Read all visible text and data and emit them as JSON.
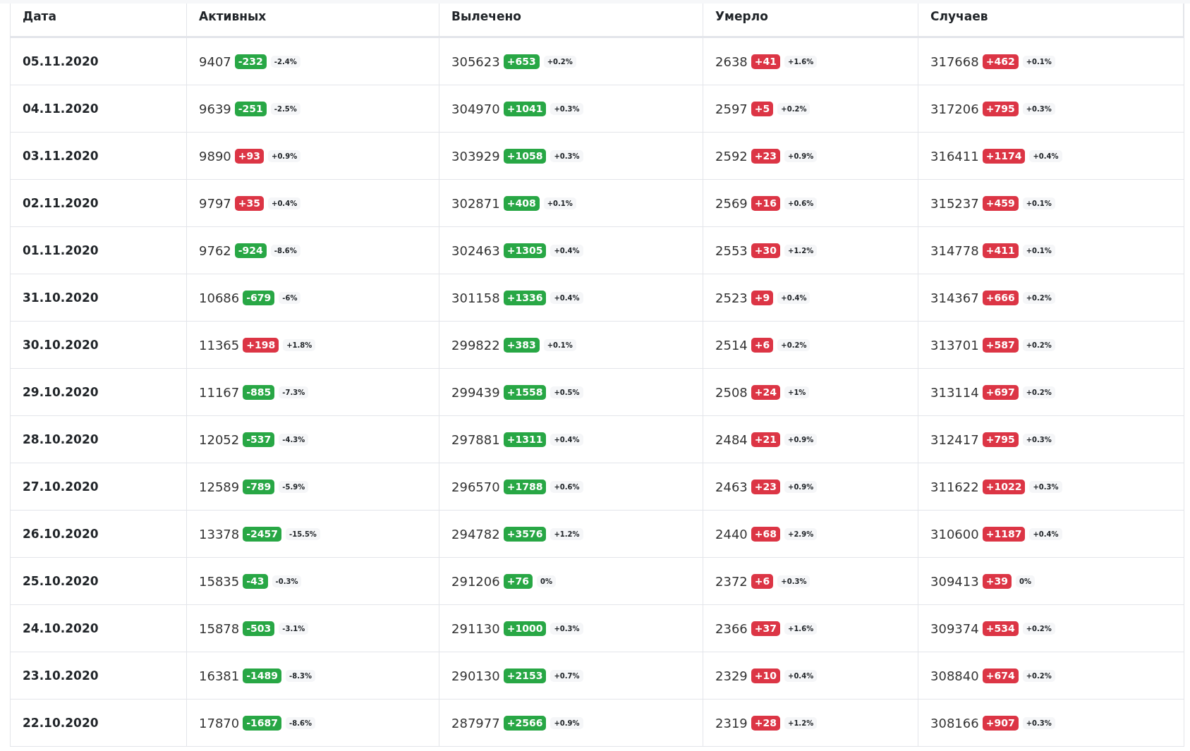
{
  "table": {
    "columns": [
      "Дата",
      "Активных",
      "Вылечено",
      "Умерло",
      "Случаев"
    ],
    "rows": [
      {
        "cells": [
          {
            "kind": "date",
            "text": "05.11.2020"
          },
          {
            "kind": "count",
            "value": "9407",
            "change": "-232",
            "color": "#28a745",
            "percent": "-2.4%"
          },
          {
            "kind": "count",
            "value": "305623",
            "change": "+653",
            "color": "#28a745",
            "percent": "+0.2%"
          },
          {
            "kind": "count",
            "value": "2638",
            "change": "+41",
            "color": "#dc3545",
            "percent": "+1.6%"
          },
          {
            "kind": "count",
            "value": "317668",
            "change": "+462",
            "color": "#dc3545",
            "percent": "+0.1%"
          }
        ]
      },
      {
        "cells": [
          {
            "kind": "date",
            "text": "04.11.2020"
          },
          {
            "kind": "count",
            "value": "9639",
            "change": "-251",
            "color": "#28a745",
            "percent": "-2.5%"
          },
          {
            "kind": "count",
            "value": "304970",
            "change": "+1041",
            "color": "#28a745",
            "percent": "+0.3%"
          },
          {
            "kind": "count",
            "value": "2597",
            "change": "+5",
            "color": "#dc3545",
            "percent": "+0.2%"
          },
          {
            "kind": "count",
            "value": "317206",
            "change": "+795",
            "color": "#dc3545",
            "percent": "+0.3%"
          }
        ]
      },
      {
        "cells": [
          {
            "kind": "date",
            "text": "03.11.2020"
          },
          {
            "kind": "count",
            "value": "9890",
            "change": "+93",
            "color": "#dc3545",
            "percent": "+0.9%"
          },
          {
            "kind": "count",
            "value": "303929",
            "change": "+1058",
            "color": "#28a745",
            "percent": "+0.3%"
          },
          {
            "kind": "count",
            "value": "2592",
            "change": "+23",
            "color": "#dc3545",
            "percent": "+0.9%"
          },
          {
            "kind": "count",
            "value": "316411",
            "change": "+1174",
            "color": "#dc3545",
            "percent": "+0.4%"
          }
        ]
      },
      {
        "cells": [
          {
            "kind": "date",
            "text": "02.11.2020"
          },
          {
            "kind": "count",
            "value": "9797",
            "change": "+35",
            "color": "#dc3545",
            "percent": "+0.4%"
          },
          {
            "kind": "count",
            "value": "302871",
            "change": "+408",
            "color": "#28a745",
            "percent": "+0.1%"
          },
          {
            "kind": "count",
            "value": "2569",
            "change": "+16",
            "color": "#dc3545",
            "percent": "+0.6%"
          },
          {
            "kind": "count",
            "value": "315237",
            "change": "+459",
            "color": "#dc3545",
            "percent": "+0.1%"
          }
        ]
      },
      {
        "cells": [
          {
            "kind": "date",
            "text": "01.11.2020"
          },
          {
            "kind": "count",
            "value": "9762",
            "change": "-924",
            "color": "#28a745",
            "percent": "-8.6%"
          },
          {
            "kind": "count",
            "value": "302463",
            "change": "+1305",
            "color": "#28a745",
            "percent": "+0.4%"
          },
          {
            "kind": "count",
            "value": "2553",
            "change": "+30",
            "color": "#dc3545",
            "percent": "+1.2%"
          },
          {
            "kind": "count",
            "value": "314778",
            "change": "+411",
            "color": "#dc3545",
            "percent": "+0.1%"
          }
        ]
      },
      {
        "cells": [
          {
            "kind": "date",
            "text": "31.10.2020"
          },
          {
            "kind": "count",
            "value": "10686",
            "change": "-679",
            "color": "#28a745",
            "percent": "-6%"
          },
          {
            "kind": "count",
            "value": "301158",
            "change": "+1336",
            "color": "#28a745",
            "percent": "+0.4%"
          },
          {
            "kind": "count",
            "value": "2523",
            "change": "+9",
            "color": "#dc3545",
            "percent": "+0.4%"
          },
          {
            "kind": "count",
            "value": "314367",
            "change": "+666",
            "color": "#dc3545",
            "percent": "+0.2%"
          }
        ]
      },
      {
        "cells": [
          {
            "kind": "date",
            "text": "30.10.2020"
          },
          {
            "kind": "count",
            "value": "11365",
            "change": "+198",
            "color": "#dc3545",
            "percent": "+1.8%"
          },
          {
            "kind": "count",
            "value": "299822",
            "change": "+383",
            "color": "#28a745",
            "percent": "+0.1%"
          },
          {
            "kind": "count",
            "value": "2514",
            "change": "+6",
            "color": "#dc3545",
            "percent": "+0.2%"
          },
          {
            "kind": "count",
            "value": "313701",
            "change": "+587",
            "color": "#dc3545",
            "percent": "+0.2%"
          }
        ]
      },
      {
        "cells": [
          {
            "kind": "date",
            "text": "29.10.2020"
          },
          {
            "kind": "count",
            "value": "11167",
            "change": "-885",
            "color": "#28a745",
            "percent": "-7.3%"
          },
          {
            "kind": "count",
            "value": "299439",
            "change": "+1558",
            "color": "#28a745",
            "percent": "+0.5%"
          },
          {
            "kind": "count",
            "value": "2508",
            "change": "+24",
            "color": "#dc3545",
            "percent": "+1%"
          },
          {
            "kind": "count",
            "value": "313114",
            "change": "+697",
            "color": "#dc3545",
            "percent": "+0.2%"
          }
        ]
      },
      {
        "cells": [
          {
            "kind": "date",
            "text": "28.10.2020"
          },
          {
            "kind": "count",
            "value": "12052",
            "change": "-537",
            "color": "#28a745",
            "percent": "-4.3%"
          },
          {
            "kind": "count",
            "value": "297881",
            "change": "+1311",
            "color": "#28a745",
            "percent": "+0.4%"
          },
          {
            "kind": "count",
            "value": "2484",
            "change": "+21",
            "color": "#dc3545",
            "percent": "+0.9%"
          },
          {
            "kind": "count",
            "value": "312417",
            "change": "+795",
            "color": "#dc3545",
            "percent": "+0.3%"
          }
        ]
      },
      {
        "cells": [
          {
            "kind": "date",
            "text": "27.10.2020"
          },
          {
            "kind": "count",
            "value": "12589",
            "change": "-789",
            "color": "#28a745",
            "percent": "-5.9%"
          },
          {
            "kind": "count",
            "value": "296570",
            "change": "+1788",
            "color": "#28a745",
            "percent": "+0.6%"
          },
          {
            "kind": "count",
            "value": "2463",
            "change": "+23",
            "color": "#dc3545",
            "percent": "+0.9%"
          },
          {
            "kind": "count",
            "value": "311622",
            "change": "+1022",
            "color": "#dc3545",
            "percent": "+0.3%"
          }
        ]
      },
      {
        "cells": [
          {
            "kind": "date",
            "text": "26.10.2020"
          },
          {
            "kind": "count",
            "value": "13378",
            "change": "-2457",
            "color": "#28a745",
            "percent": "-15.5%"
          },
          {
            "kind": "count",
            "value": "294782",
            "change": "+3576",
            "color": "#28a745",
            "percent": "+1.2%"
          },
          {
            "kind": "count",
            "value": "2440",
            "change": "+68",
            "color": "#dc3545",
            "percent": "+2.9%"
          },
          {
            "kind": "count",
            "value": "310600",
            "change": "+1187",
            "color": "#dc3545",
            "percent": "+0.4%"
          }
        ]
      },
      {
        "cells": [
          {
            "kind": "date",
            "text": "25.10.2020"
          },
          {
            "kind": "count",
            "value": "15835",
            "change": "-43",
            "color": "#28a745",
            "percent": "-0.3%"
          },
          {
            "kind": "count",
            "value": "291206",
            "change": "+76",
            "color": "#28a745",
            "percent": "0%"
          },
          {
            "kind": "count",
            "value": "2372",
            "change": "+6",
            "color": "#dc3545",
            "percent": "+0.3%"
          },
          {
            "kind": "count",
            "value": "309413",
            "change": "+39",
            "color": "#dc3545",
            "percent": "0%"
          }
        ]
      },
      {
        "cells": [
          {
            "kind": "date",
            "text": "24.10.2020"
          },
          {
            "kind": "count",
            "value": "15878",
            "change": "-503",
            "color": "#28a745",
            "percent": "-3.1%"
          },
          {
            "kind": "count",
            "value": "291130",
            "change": "+1000",
            "color": "#28a745",
            "percent": "+0.3%"
          },
          {
            "kind": "count",
            "value": "2366",
            "change": "+37",
            "color": "#dc3545",
            "percent": "+1.6%"
          },
          {
            "kind": "count",
            "value": "309374",
            "change": "+534",
            "color": "#dc3545",
            "percent": "+0.2%"
          }
        ]
      },
      {
        "cells": [
          {
            "kind": "date",
            "text": "23.10.2020"
          },
          {
            "kind": "count",
            "value": "16381",
            "change": "-1489",
            "color": "#28a745",
            "percent": "-8.3%"
          },
          {
            "kind": "count",
            "value": "290130",
            "change": "+2153",
            "color": "#28a745",
            "percent": "+0.7%"
          },
          {
            "kind": "count",
            "value": "2329",
            "change": "+10",
            "color": "#dc3545",
            "percent": "+0.4%"
          },
          {
            "kind": "count",
            "value": "308840",
            "change": "+674",
            "color": "#dc3545",
            "percent": "+0.2%"
          }
        ]
      },
      {
        "cells": [
          {
            "kind": "date",
            "text": "22.10.2020"
          },
          {
            "kind": "count",
            "value": "17870",
            "change": "-1687",
            "color": "#28a745",
            "percent": "-8.6%"
          },
          {
            "kind": "count",
            "value": "287977",
            "change": "+2566",
            "color": "#28a745",
            "percent": "+0.9%"
          },
          {
            "kind": "count",
            "value": "2319",
            "change": "+28",
            "color": "#dc3545",
            "percent": "+1.2%"
          },
          {
            "kind": "count",
            "value": "308166",
            "change": "+907",
            "color": "#dc3545",
            "percent": "+0.3%"
          }
        ]
      }
    ]
  }
}
